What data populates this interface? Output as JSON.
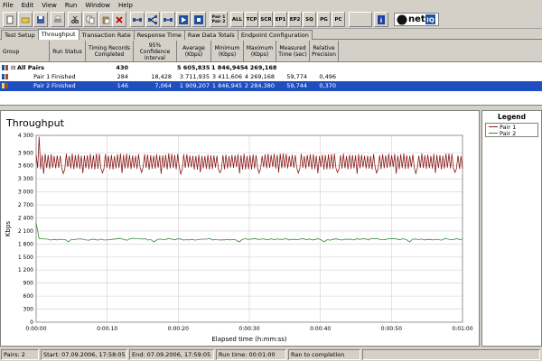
{
  "menu": [
    "File",
    "Edit",
    "View",
    "Run",
    "Window",
    "Help"
  ],
  "toolbar": {
    "pair_label": "Pair 1\nPair 2",
    "protocols": [
      "ALL",
      "TCP",
      "SCR",
      "EP1",
      "EP2",
      "SQ",
      "PG",
      "PC"
    ],
    "brand": "net"
  },
  "tabs": [
    "Test Setup",
    "Throughput",
    "Transaction Rate",
    "Response Time",
    "Raw Data Totals",
    "Endpoint Configuration"
  ],
  "active_tab": "Throughput",
  "grid": {
    "headers": [
      "Group",
      "Run Status",
      "Timing Records\nCompleted",
      "95% Confidence\nInterval",
      "Average\n(Kbps)",
      "Minimum\n(Kbps)",
      "Maximum\n(Kbps)",
      "Measured\nTime (sec)",
      "Relative\nPrecision"
    ],
    "rows": [
      {
        "group": "All Pairs",
        "status": "",
        "records": "430",
        "ci": "",
        "avg": "5 605,835",
        "min": "1 846,945",
        "max": "4 269,168",
        "time": "",
        "precision": ""
      },
      {
        "group": "Pair 1",
        "status": "Finished",
        "records": "284",
        "ci": "18,428",
        "avg": "3 711,935",
        "min": "3 411,606",
        "max": "4 269,168",
        "time": "59,774",
        "precision": "0,496"
      },
      {
        "group": "Pair 2",
        "status": "Finished",
        "records": "146",
        "ci": "7,064",
        "avg": "1 909,207",
        "min": "1 846,945",
        "max": "2 284,380",
        "time": "59,744",
        "precision": "0,370"
      }
    ]
  },
  "legend": {
    "title": "Legend",
    "items": [
      "Pair 1",
      "Pair 2"
    ]
  },
  "colors": {
    "pair1": "#8b1a1a",
    "pair2": "#2e8b2e"
  },
  "chart_data": {
    "type": "line",
    "title": "Throughput",
    "xlabel": "Elapsed time (h:mm:ss)",
    "ylabel": "Kbps",
    "x_ticks": [
      "0:00:00",
      "0:00:10",
      "0:00:20",
      "0:00:30",
      "0:00:40",
      "0:00:50",
      "0:01:00"
    ],
    "y_ticks": [
      "0",
      "300",
      "600",
      "900",
      "1 200",
      "1 500",
      "1 800",
      "2 100",
      "2 400",
      "2 700",
      "3 000",
      "3 300",
      "3 600",
      "3 900",
      "4 300"
    ],
    "xlim": [
      0,
      60
    ],
    "series": [
      {
        "name": "Pair 1",
        "mean": 3712,
        "min": 3412,
        "max": 4269
      },
      {
        "name": "Pair 2",
        "mean": 1909,
        "min": 1847,
        "max": 2284
      }
    ]
  },
  "status": {
    "pairs": "Pairs: 2",
    "start": "Start: 07.09.2006, 17:58:05",
    "end": "End: 07.09.2006, 17:59:05",
    "run_time": "Run time: 00:01:00",
    "mode": "Ran to completion"
  }
}
